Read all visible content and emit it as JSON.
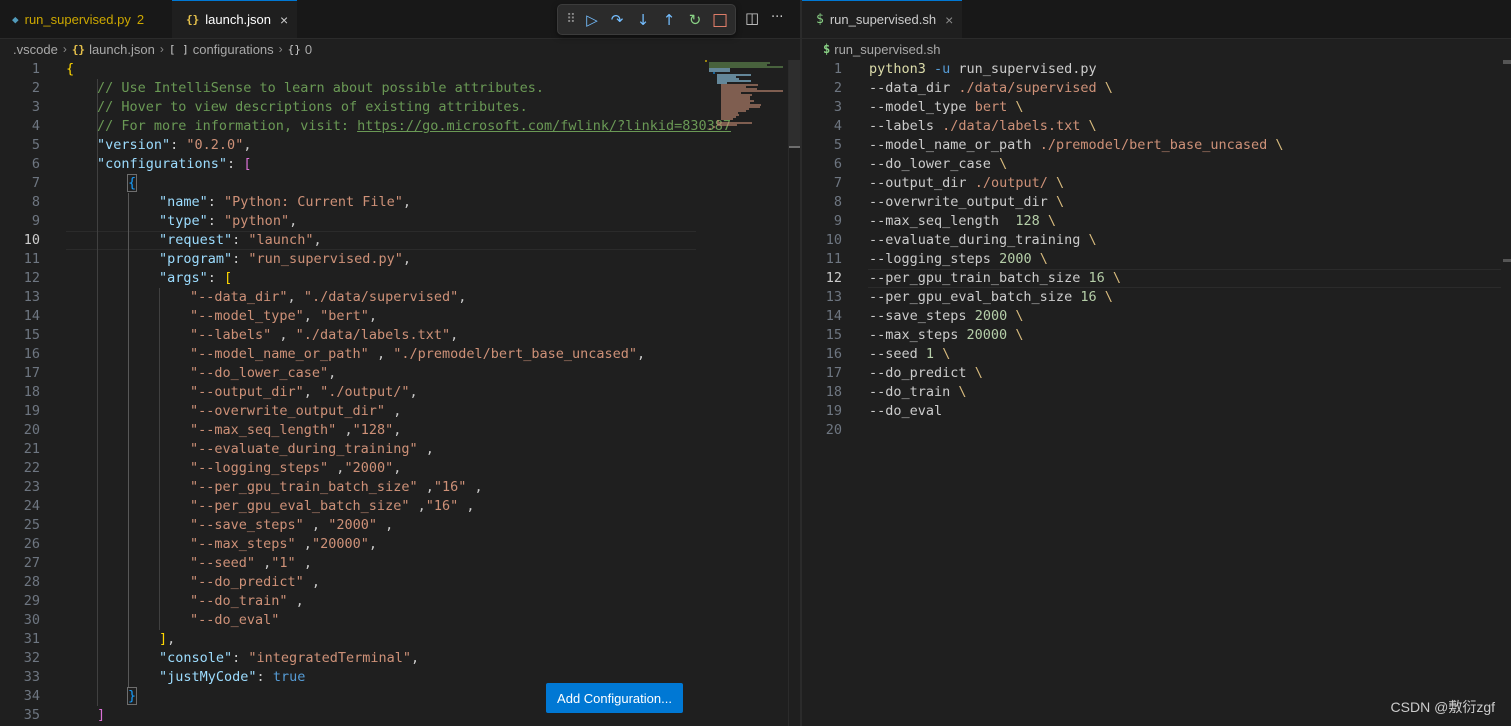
{
  "left_editor": {
    "tabs": [
      {
        "label": "run_supervised.py",
        "badge": "2",
        "icon": "python-icon"
      },
      {
        "label": "launch.json",
        "icon": "json-braces-icon",
        "close": "×"
      }
    ],
    "breadcrumb": [
      {
        "label": ".vscode"
      },
      {
        "label": "launch.json",
        "icon": "{}"
      },
      {
        "label": "configurations",
        "icon": "[ ]"
      },
      {
        "label": "0",
        "icon": "{}"
      }
    ],
    "debug_toolbar": {
      "grip": "⠿",
      "continue": "▷",
      "step_over": "↷",
      "step_into": "↓",
      "step_out": "↑",
      "restart": "↻",
      "stop": "□"
    },
    "actions": {
      "split": "◫",
      "more": "···"
    },
    "current_line": 10,
    "line_numbers": [
      "1",
      "2",
      "3",
      "4",
      "5",
      "6",
      "7",
      "8",
      "9",
      "10",
      "11",
      "12",
      "13",
      "14",
      "15",
      "16",
      "17",
      "18",
      "19",
      "20",
      "21",
      "22",
      "23",
      "24",
      "25",
      "26",
      "27",
      "28",
      "29",
      "30",
      "31",
      "32",
      "33",
      "34",
      "35"
    ],
    "code": {
      "l1": "{",
      "l2": "// Use IntelliSense to learn about possible attributes.",
      "l3": "// Hover to view descriptions of existing attributes.",
      "l4_text": "// For more information, visit: ",
      "l4_url": "https://go.microsoft.com/fwlink/?linkid=830387",
      "l5_key": "\"version\"",
      "l5_val": "\"0.2.0\"",
      "l6_key": "\"configurations\"",
      "l6_br": "[",
      "l7": "{",
      "l8_key": "\"name\"",
      "l8_val": "\"Python: Current File\"",
      "l9_key": "\"type\"",
      "l9_val": "\"python\"",
      "l10_key": "\"request\"",
      "l10_val": "\"launch\"",
      "l11_key": "\"program\"",
      "l11_val": "\"run_supervised.py\"",
      "l12_key": "\"args\"",
      "l12_br": "[",
      "args": [
        "\"--data_dir\", \"./data/supervised\",",
        "\"--model_type\", \"bert\",",
        "\"--labels\" , \"./data/labels.txt\",",
        "\"--model_name_or_path\" , \"./premodel/bert_base_uncased\",",
        "\"--do_lower_case\",",
        "\"--output_dir\", \"./output/\",",
        "\"--overwrite_output_dir\" ,",
        "\"--max_seq_length\" ,\"128\",",
        "\"--evaluate_during_training\" ,",
        "\"--logging_steps\" ,\"2000\",",
        "\"--per_gpu_train_batch_size\" ,\"16\" ,",
        "\"--per_gpu_eval_batch_size\" ,\"16\" ,",
        "\"--save_steps\" , \"2000\" ,",
        "\"--max_steps\" ,\"20000\",",
        "\"--seed\" ,\"1\" ,",
        "\"--do_predict\" ,",
        "\"--do_train\" ,",
        "\"--do_eval\""
      ],
      "l31": "]",
      "l32_key": "\"console\"",
      "l32_val": "\"integratedTerminal\"",
      "l33_key": "\"justMyCode\"",
      "l33_val": "true",
      "l34": "}",
      "l35": "]"
    },
    "add_configuration_label": "Add Configuration..."
  },
  "right_editor": {
    "tab": {
      "label": "run_supervised.sh",
      "icon": "$",
      "close": "×"
    },
    "breadcrumb": {
      "icon": "$",
      "label": "run_supervised.sh"
    },
    "current_line": 12,
    "line_numbers": [
      "1",
      "2",
      "3",
      "4",
      "5",
      "6",
      "7",
      "8",
      "9",
      "10",
      "11",
      "12",
      "13",
      "14",
      "15",
      "16",
      "17",
      "18",
      "19",
      "20"
    ],
    "lines": [
      {
        "t": "python3",
        "parts": [
          {
            "c": "sh-flag",
            "v": " -u"
          },
          {
            "c": "sh-arg",
            "v": " run_supervised.py"
          }
        ]
      },
      {
        "t": "--data_dir ./data/supervised \\"
      },
      {
        "t": "--model_type bert \\"
      },
      {
        "t": "--labels ./data/labels.txt \\"
      },
      {
        "t": "--model_name_or_path ./premodel/bert_base_uncased \\"
      },
      {
        "t": "--do_lower_case \\"
      },
      {
        "t": "--output_dir ./output/ \\"
      },
      {
        "t": "--overwrite_output_dir \\"
      },
      {
        "t": "--max_seq_length  128 \\"
      },
      {
        "t": "--evaluate_during_training \\"
      },
      {
        "t": "--logging_steps 2000 \\"
      },
      {
        "t": "--per_gpu_train_batch_size 16 \\"
      },
      {
        "t": "--per_gpu_eval_batch_size 16 \\"
      },
      {
        "t": "--save_steps 2000 \\"
      },
      {
        "t": "--max_steps 20000 \\"
      },
      {
        "t": "--seed 1 \\"
      },
      {
        "t": "--do_predict \\"
      },
      {
        "t": "--do_train \\"
      },
      {
        "t": "--do_eval"
      },
      {
        "t": ""
      }
    ]
  },
  "watermark": "CSDN @敷衍zgf",
  "colors": {
    "accent": "#0078d4",
    "string": "#ce9178",
    "key": "#9cdcfe",
    "comment": "#6a9955"
  }
}
